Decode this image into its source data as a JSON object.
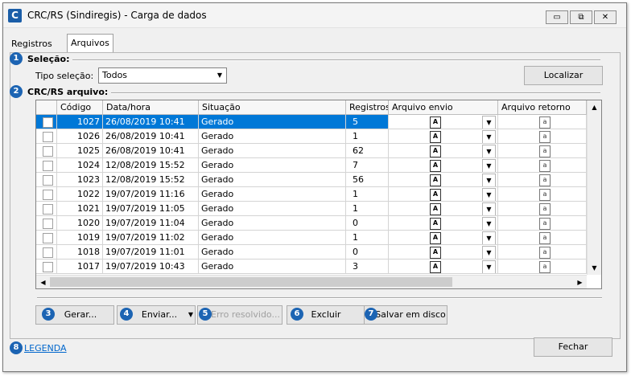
{
  "window": {
    "title": "CRC/RS (Sindiregis) - Carga de dados",
    "app_icon_letter": "C",
    "minimize": "▭",
    "maximize": "⧉",
    "close": "✕"
  },
  "tabs": [
    {
      "label": "Registros",
      "active": false
    },
    {
      "label": "Arquivos",
      "active": true
    }
  ],
  "badges": [
    "1",
    "2",
    "3",
    "4",
    "5",
    "6",
    "7",
    "8"
  ],
  "selecao": {
    "section_label": "Seleção:",
    "tipo_label": "Tipo seleção:",
    "tipo_value": "Todos",
    "localizar_label": "Localizar"
  },
  "arquivo": {
    "section_label": "CRC/RS arquivo:"
  },
  "table": {
    "headers": [
      "",
      "Código",
      "Data/hora",
      "Situação",
      "Registros",
      "Arquivo envio",
      "Arquivo retorno"
    ],
    "rows": [
      {
        "codigo": "1027",
        "datahora": "26/08/2019 10:41",
        "situacao": "Gerado",
        "registros": "5",
        "selected": true
      },
      {
        "codigo": "1026",
        "datahora": "26/08/2019 10:41",
        "situacao": "Gerado",
        "registros": "1",
        "selected": false
      },
      {
        "codigo": "1025",
        "datahora": "26/08/2019 10:41",
        "situacao": "Gerado",
        "registros": "62",
        "selected": false
      },
      {
        "codigo": "1024",
        "datahora": "12/08/2019 15:52",
        "situacao": "Gerado",
        "registros": "7",
        "selected": false
      },
      {
        "codigo": "1023",
        "datahora": "12/08/2019 15:52",
        "situacao": "Gerado",
        "registros": "56",
        "selected": false
      },
      {
        "codigo": "1022",
        "datahora": "19/07/2019 11:16",
        "situacao": "Gerado",
        "registros": "1",
        "selected": false
      },
      {
        "codigo": "1021",
        "datahora": "19/07/2019 11:05",
        "situacao": "Gerado",
        "registros": "1",
        "selected": false
      },
      {
        "codigo": "1020",
        "datahora": "19/07/2019 11:04",
        "situacao": "Gerado",
        "registros": "0",
        "selected": false
      },
      {
        "codigo": "1019",
        "datahora": "19/07/2019 11:02",
        "situacao": "Gerado",
        "registros": "1",
        "selected": false
      },
      {
        "codigo": "1018",
        "datahora": "19/07/2019 11:01",
        "situacao": "Gerado",
        "registros": "0",
        "selected": false
      },
      {
        "codigo": "1017",
        "datahora": "19/07/2019 10:43",
        "situacao": "Gerado",
        "registros": "3",
        "selected": false
      }
    ],
    "envio_icon": "A",
    "retorno_icon": "a"
  },
  "actions": {
    "gerar": "Gerar...",
    "enviar": "Enviar...",
    "erro": "Erro resolvido...",
    "excluir": "Excluir",
    "salvar": "Salvar em disco"
  },
  "footer": {
    "legenda": "LEGENDA",
    "fechar": "Fechar"
  },
  "colors": {
    "accent": "#0078d7",
    "badge": "#1c64b3",
    "link": "#0066cc"
  }
}
